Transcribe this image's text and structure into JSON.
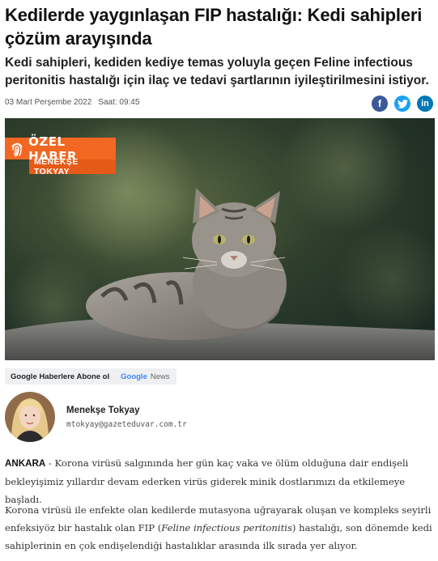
{
  "article": {
    "headline": "Kedilerde yaygınlaşan FIP hastalığı: Kedi sahipleri çözüm arayışında",
    "summary": "Kedi sahipleri, kediden kediye temas yoluyla geçen Feline infectious peritonitis hastalığı için ilaç ve tedavi şartlarının iyileştirilmesini istiyor.",
    "date": "03 Mart Perşembe 2022",
    "time": "Saat: 09:45"
  },
  "share": {
    "icons": [
      "facebook-icon",
      "twitter-icon",
      "linkedin-icon"
    ],
    "facebook": "f",
    "twitter": "t",
    "linkedin": "in",
    "colors": {
      "facebook": "#3b5998",
      "twitter": "#1da1f2",
      "linkedin": "#0077b5"
    }
  },
  "hero": {
    "badge_title": "ÖZEL HABER",
    "badge_author": "MENEKŞE TOKYAY",
    "badge_color": "#f26722"
  },
  "google_news": {
    "follow_label": "Google Haberlere Abone ol",
    "brand_google": "Google",
    "brand_news": "News"
  },
  "author": {
    "name": "Menekşe Tokyay",
    "email": "mtokyay@gazeteduvar.com.tr"
  },
  "body": {
    "p1_location": "ANKARA",
    "p1_text": " - Korona virüsü salgınında her gün kaç vaka ve ölüm olduğuna dair endişeli bekleyişimiz yıllardır devam ederken virüs giderek minik dostlarımızı da etkilemeye başladı.",
    "p2_before": "Korona virüsü ile enfekte olan kedilerde mutasyona uğrayarak oluşan ve kompleks seyirli enfeksiyöz bir hastalık olan FIP (",
    "p2_italic": "Feline infectious peritonitis",
    "p2_after": ") hastalığı, son dönemde kedi sahiplerinin en çok endişelendiği hastalıklar arasında ilk sırada yer alıyor."
  }
}
